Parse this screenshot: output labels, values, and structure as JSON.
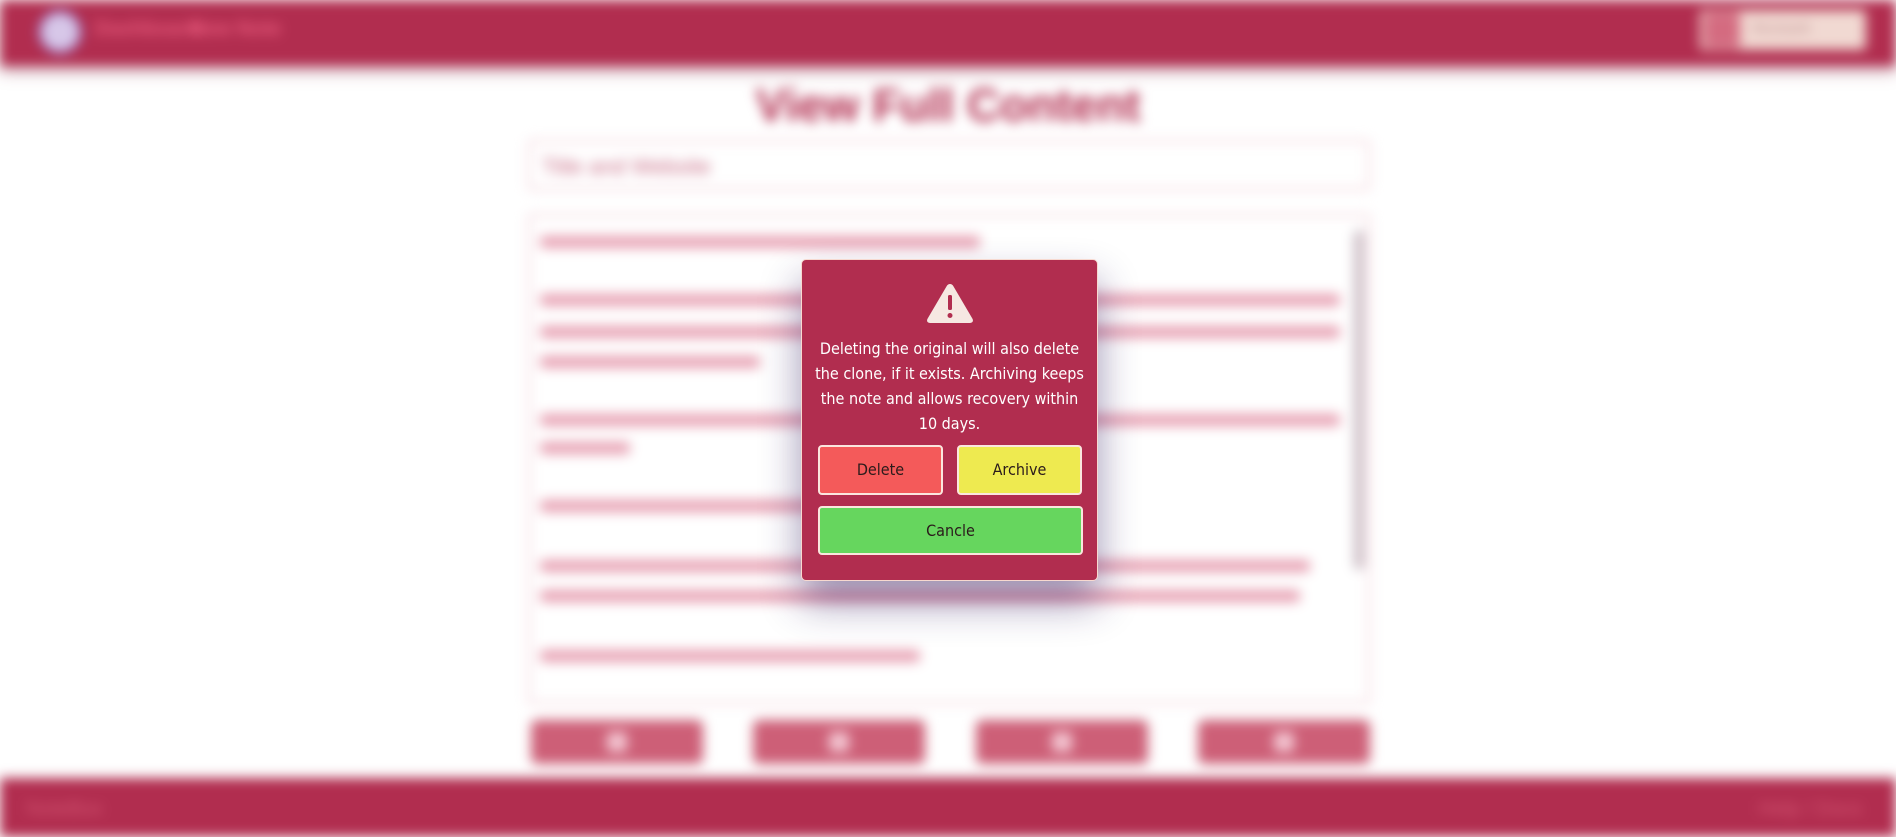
{
  "background": {
    "nav": {
      "link_1": "Dashboard",
      "link_2": "New Note",
      "user_button": "Account"
    },
    "page_title": "View Full Content",
    "title_field_value": "Title and Website",
    "action_buttons": [
      "edit-icon",
      "clone-icon",
      "share-icon",
      "delete-icon"
    ],
    "footer": {
      "left": "NoteBox",
      "right": "Help / Docs"
    }
  },
  "modal": {
    "icon": "warning-triangle-icon",
    "message": "Deleting the original will also delete the clone, if it exists. Archiving keeps the note and allows recovery within 10 days.",
    "buttons": {
      "delete": "Delete",
      "archive": "Archive",
      "cancel": "Cancle"
    }
  },
  "colors": {
    "brand": "#b12d4f",
    "delete": "#f45a5a",
    "archive": "#eeea50",
    "cancel": "#66d65e"
  }
}
